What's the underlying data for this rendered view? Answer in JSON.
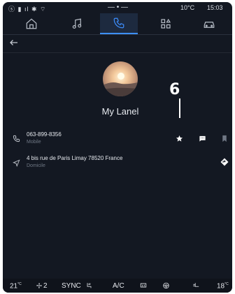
{
  "status": {
    "left_icons": "ⓢ ▮ ıl ✱ ⌔",
    "temperature": "10°C",
    "time": "15:03"
  },
  "nav": {
    "tabs": [
      {
        "name": "home-icon",
        "active": false
      },
      {
        "name": "music-icon",
        "active": false
      },
      {
        "name": "phone-icon",
        "active": true
      },
      {
        "name": "apps-icon",
        "active": false
      },
      {
        "name": "car-icon",
        "active": false
      }
    ]
  },
  "contact": {
    "name": "My Lanel",
    "phone": "063-899-8356",
    "phone_type": "Mobile",
    "address": "4 bis rue de Paris Limay 78520 France",
    "address_type": "Domicile"
  },
  "callout": {
    "number": "6"
  },
  "climate": {
    "left_temp": "21",
    "left_temp_unit": "°C",
    "fan_speed": "2",
    "sync_label": "SYNC",
    "ac_label": "A/C",
    "right_temp": "18",
    "right_temp_unit": "°C"
  },
  "colors": {
    "accent": "#3d8fff",
    "background": "#131822",
    "text": "#e6e9ee"
  }
}
